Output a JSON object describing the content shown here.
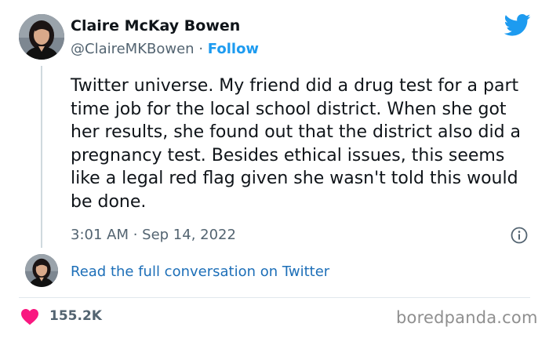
{
  "author": {
    "name": "Claire McKay Bowen",
    "handle": "@ClaireMKBowen",
    "separator": "·",
    "follow_label": "Follow"
  },
  "tweet": {
    "text": "Twitter universe. My friend did a drug test for a part time job for the local school district. When she got her results, she found out that the district also did a pregnancy test. Besides ethical issues, this seems like a legal red flag given she wasn't told this would be done.",
    "timestamp": "3:01 AM · Sep 14, 2022"
  },
  "conversation": {
    "link_label": "Read the full conversation on Twitter"
  },
  "engagement": {
    "likes": "155.2K"
  },
  "watermark": "boredpanda.com",
  "icons": {
    "brand": "twitter-bird-icon",
    "info": "info-icon",
    "like": "heart-icon"
  },
  "colors": {
    "accent": "#1d9bf0",
    "like": "#f91880",
    "secondary_text": "#536471"
  }
}
